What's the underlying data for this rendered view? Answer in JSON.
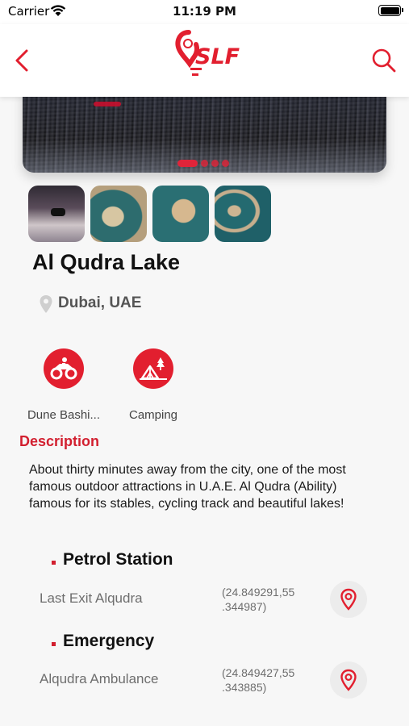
{
  "status_bar": {
    "carrier": "Carrier",
    "time": "11:19 PM"
  },
  "header": {
    "logo_text": "SLF",
    "brand_color": "#e21f2f"
  },
  "gallery": {
    "dot_count": 4,
    "active_index": 0,
    "thumbnail_count": 4
  },
  "place": {
    "title": "Al Qudra Lake",
    "location": "Dubai, UAE"
  },
  "activities": [
    {
      "label": "Dune Bashi...",
      "icon": "atv-icon"
    },
    {
      "label": "Camping",
      "icon": "camping-tent-icon"
    }
  ],
  "description": {
    "heading": "Description",
    "text": "About thirty minutes away from the city, one of the most famous outdoor attractions in U.A.E. Al Qudra (Ability) famous for its stables, cycling track and beautiful lakes!"
  },
  "sections": [
    {
      "title": "Petrol Station",
      "items": [
        {
          "name": "Last Exit Alqudra",
          "coords": "(24.849291,55 .344987)"
        }
      ]
    },
    {
      "title": "Emergency",
      "items": [
        {
          "name": "Alqudra Ambulance",
          "coords": "(24.849427,55 .343885)"
        }
      ]
    }
  ]
}
